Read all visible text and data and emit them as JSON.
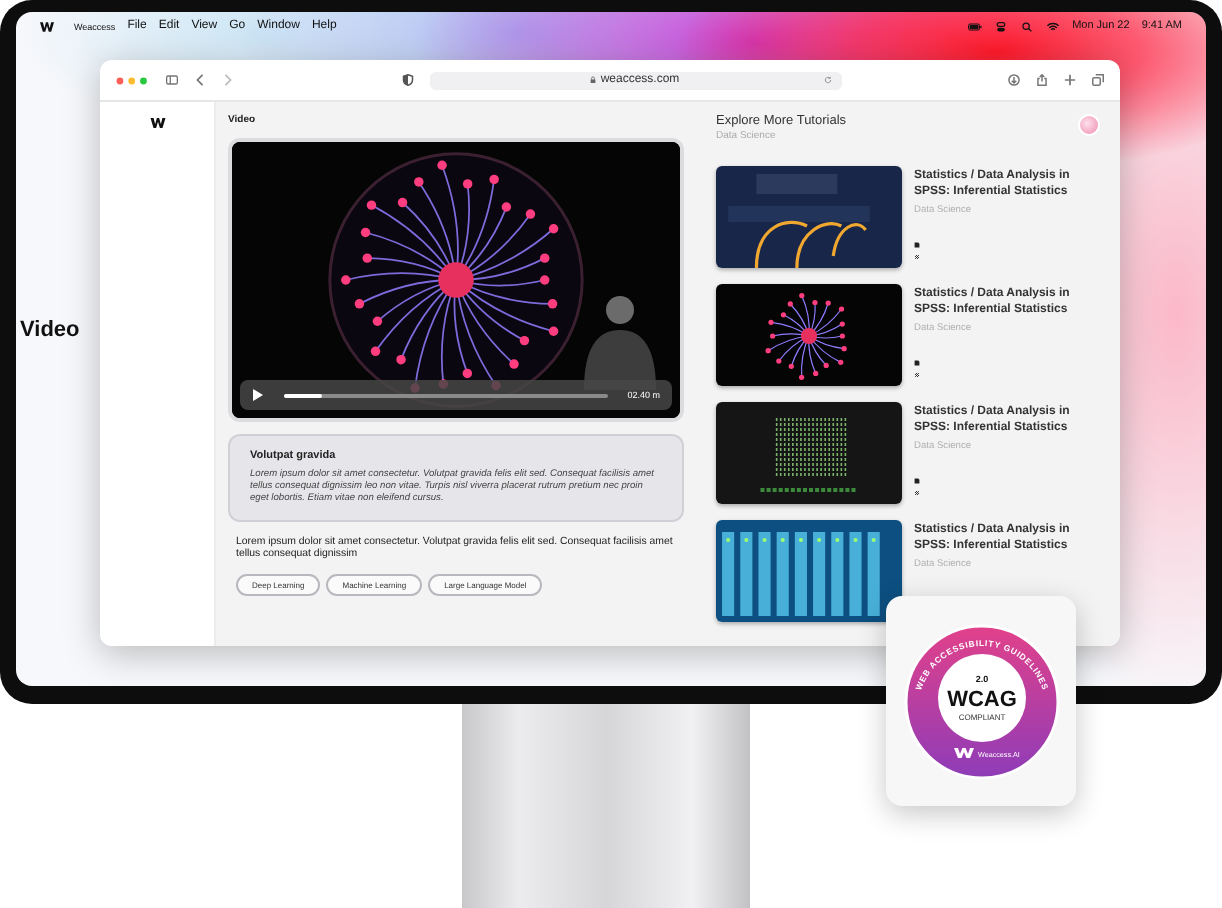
{
  "menu_bar": {
    "app_name": "Weaccess",
    "menus": [
      "File",
      "Edit",
      "View",
      "Go",
      "Window",
      "Help"
    ],
    "date": "Mon Jun 22",
    "time": "9:41 AM"
  },
  "side_label": "Video",
  "browser": {
    "url": "weaccess.com"
  },
  "video_section": {
    "heading": "Video",
    "progress": {
      "level": 0.12
    },
    "time": "02.40 m"
  },
  "info_card": {
    "title": "Volutpat gravida",
    "text": "Lorem ipsum dolor sit amet consectetur. Volutpat gravida felis elit sed. Consequat facilisis amet tellus consequat dignissim leo non vitae. Turpis nisl viverra placerat rutrum pretium nec proin eget lobortis. Etiam vitae non eleifend cursus."
  },
  "description": "Lorem ipsum dolor sit amet consectetur. Volutpat gravida felis elit sed. Consequat facilisis amet tellus consequat dignissim",
  "tags": [
    "Deep Learning",
    "Machine Learning",
    "Large Language Model"
  ],
  "tutorials": {
    "heading": "Explore More Tutorials",
    "subheading": "Data Science",
    "items": [
      {
        "kind": "cables",
        "title": "Statistics / Data Analysis in SPSS: Inferential Statistics",
        "category": "Data Science"
      },
      {
        "kind": "plasma",
        "title": "Statistics / Data Analysis in SPSS: Inferential Statistics",
        "category": "Data Science"
      },
      {
        "kind": "code",
        "title": "Statistics / Data Analysis in SPSS: Inferential Statistics",
        "category": "Data Science"
      },
      {
        "kind": "servers",
        "title": "Statistics / Data Analysis in SPSS: Inferential Statistics",
        "category": "Data Science"
      }
    ]
  },
  "badge": {
    "ring_text": "WEB ACCESSIBILITY GUIDELINES",
    "version": "2.0",
    "title": "WCAG",
    "status": "COMPLIANT",
    "brand": "Weaccess.AI"
  }
}
